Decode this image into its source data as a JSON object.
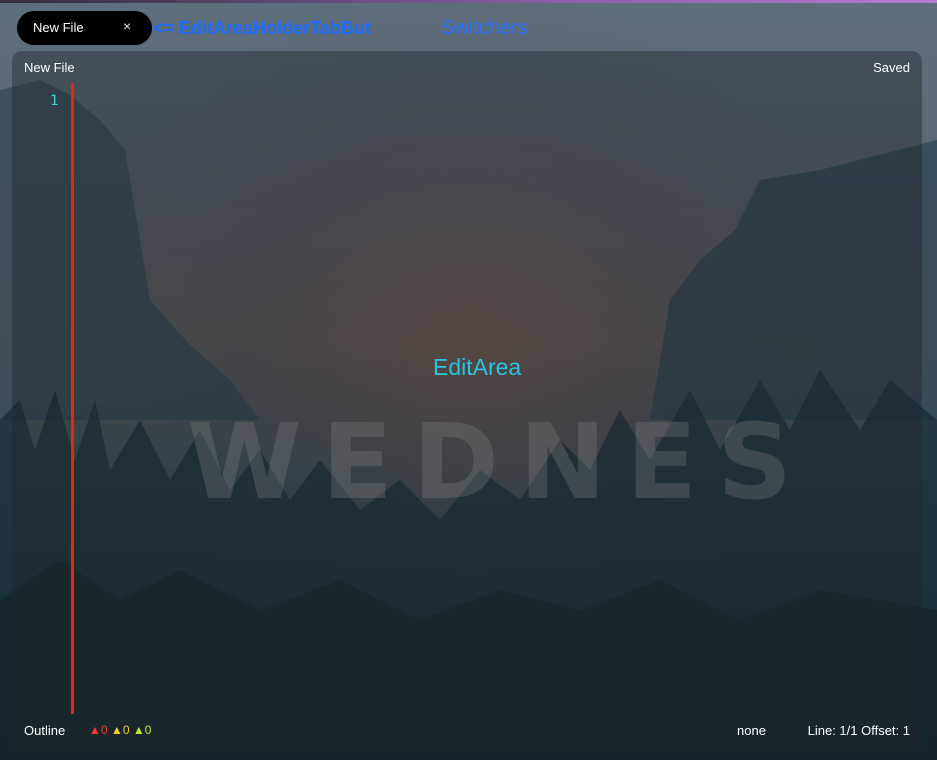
{
  "tab": {
    "label": "New File",
    "close_icon": "×"
  },
  "annotation": "<= EditAreaHolderTabBut",
  "switchers": "Switchers",
  "editor": {
    "file_name": "New File",
    "save_status": "Saved",
    "line_number": "1",
    "area_label": "EditArea",
    "watermark": "WEDNES"
  },
  "status_bar": {
    "outline": "Outline",
    "error_icon": "▲",
    "error_count": "0",
    "warning_icon": "▲",
    "warning_count": "0",
    "info_icon": "▲",
    "info_count": "0",
    "mode": "none",
    "position": "Line: 1/1 Offset: 1"
  },
  "colors": {
    "error": "#ff3b2f",
    "warning": "#f5d21b",
    "info": "#b6f226",
    "annotation": "#1e6bff",
    "editarea": "#29c3e6"
  }
}
